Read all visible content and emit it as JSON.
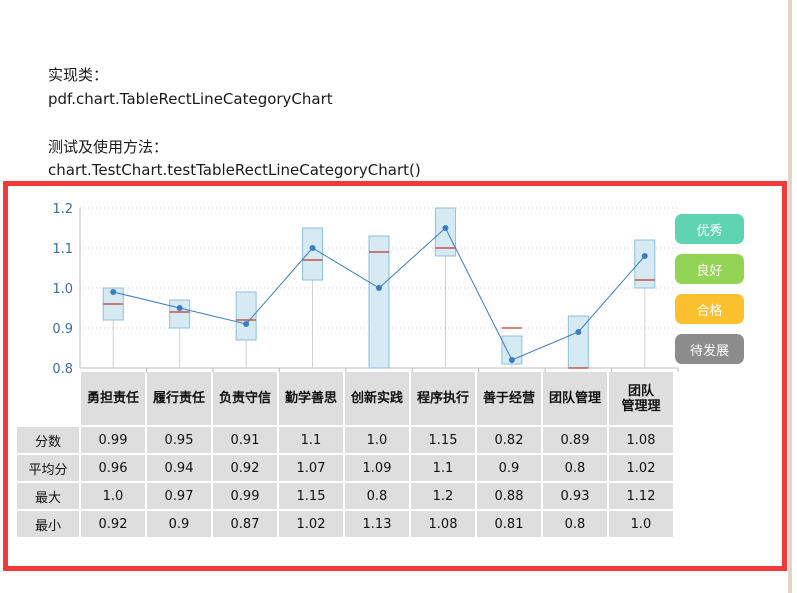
{
  "intro": {
    "class_label": "实现类：",
    "class_name": "pdf.chart.TableRectLineCategoryChart",
    "test_label": "测试及使用方法：",
    "test_call": "chart.TestChart.testTableRectLineCategoryChart()"
  },
  "legend": [
    {
      "label": "优秀",
      "color": "#5ed4b0"
    },
    {
      "label": "良好",
      "color": "#93d355"
    },
    {
      "label": "合格",
      "color": "#fbc02d"
    },
    {
      "label": "待发展",
      "color": "#8c8c8c"
    }
  ],
  "chart_data": {
    "type": "table",
    "categories": [
      "勇担责任",
      "履行责任",
      "负责守信",
      "勤学善思",
      "创新实践",
      "程序执行",
      "善于经营",
      "团队管理",
      "团队管理理"
    ],
    "series": [
      {
        "name": "分数",
        "values": [
          0.99,
          0.95,
          0.91,
          1.1,
          1.0,
          1.15,
          0.82,
          0.89,
          1.08
        ]
      },
      {
        "name": "平均分",
        "values": [
          0.96,
          0.94,
          0.92,
          1.07,
          1.09,
          1.1,
          0.9,
          0.8,
          1.02
        ]
      },
      {
        "name": "最大",
        "values": [
          1.0,
          0.97,
          0.99,
          1.15,
          0.8,
          1.2,
          0.88,
          0.93,
          1.12
        ]
      },
      {
        "name": "最小",
        "values": [
          0.92,
          0.9,
          0.87,
          1.02,
          1.13,
          1.08,
          0.81,
          0.8,
          1.0
        ]
      }
    ],
    "y_ticks": [
      "0.8",
      "0.9",
      "1.0",
      "1.1",
      "1.2"
    ],
    "ylim": [
      0.8,
      1.2
    ],
    "grid": true,
    "legend_position": "right"
  },
  "table": {
    "headers": [
      "勇担责任",
      "履行责任",
      "负责守信",
      "勤学善思",
      "创新实践",
      "程序执行",
      "善于经营",
      "团队管理",
      "团队\n管理理"
    ],
    "rows": [
      {
        "label": "分数",
        "cells": [
          "0.99",
          "0.95",
          "0.91",
          "1.1",
          "1.0",
          "1.15",
          "0.82",
          "0.89",
          "1.08"
        ]
      },
      {
        "label": "平均分",
        "cells": [
          "0.96",
          "0.94",
          "0.92",
          "1.07",
          "1.09",
          "1.1",
          "0.9",
          "0.8",
          "1.02"
        ]
      },
      {
        "label": "最大",
        "cells": [
          "1.0",
          "0.97",
          "0.99",
          "1.15",
          "0.8",
          "1.2",
          "0.88",
          "0.93",
          "1.12"
        ]
      },
      {
        "label": "最小",
        "cells": [
          "0.92",
          "0.9",
          "0.87",
          "1.02",
          "1.13",
          "1.08",
          "0.81",
          "0.8",
          "1.0"
        ]
      }
    ]
  },
  "colors": {
    "frame": "#ef3b3b",
    "line": "#3b7dc4",
    "box_fill": "#d6eaf3",
    "box_stroke": "#8fbfdc",
    "avg_mark": "#c0392b",
    "axis_text": "#3b6ea5"
  }
}
